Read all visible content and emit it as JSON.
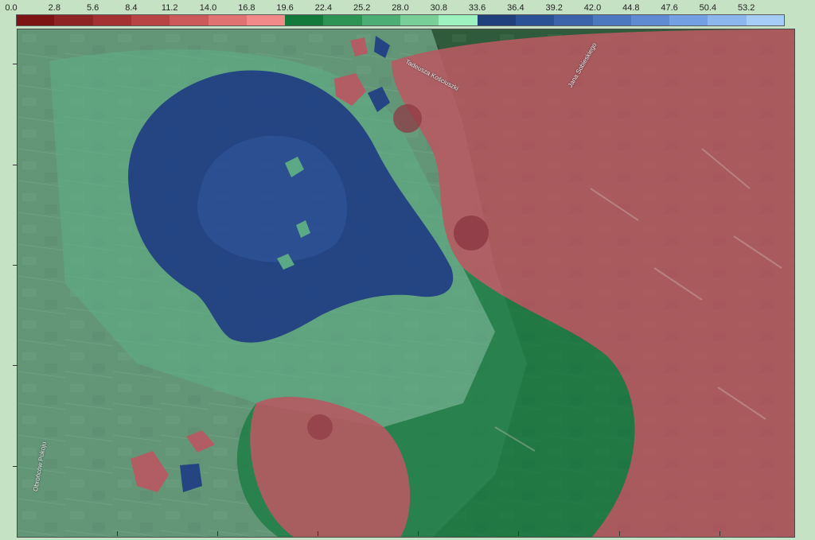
{
  "legend": {
    "labels": [
      "0.0",
      "2.8",
      "5.6",
      "8.4",
      "11.2",
      "14.0",
      "16.8",
      "19.6",
      "22.4",
      "25.2",
      "28.0",
      "30.8",
      "33.6",
      "36.4",
      "39.2",
      "42.0",
      "44.8",
      "47.6",
      "50.4",
      "53.2"
    ],
    "colors": [
      "#7d1414",
      "#8e2424",
      "#a43232",
      "#b84444",
      "#cd5a5a",
      "#e07272",
      "#f28a8a",
      "#137a3c",
      "#2e9456",
      "#4cae74",
      "#78cf98",
      "#9ef2c0",
      "#1f3f7d",
      "#2c5296",
      "#3b64ab",
      "#4c78c0",
      "#5e8bd2",
      "#73a0e2",
      "#8cb6ee",
      "#a6cdf8"
    ]
  },
  "map": {
    "street_labels": [
      "Tadeusza Kościuszki",
      "Jana Sobieskiego",
      "Obrońców Pokoju"
    ],
    "colors": {
      "background": "#c6e2c4",
      "aerial_base": "#2f5a3b",
      "red_zone": "#b65a62",
      "red_core": "#8e3a44",
      "green_zone": "#1f7e45",
      "light_green_zone": "#5fae86",
      "pale_green_zone": "#8ec9a9",
      "blue_zone": "#213f83",
      "blue_inner": "#2e5296"
    }
  }
}
